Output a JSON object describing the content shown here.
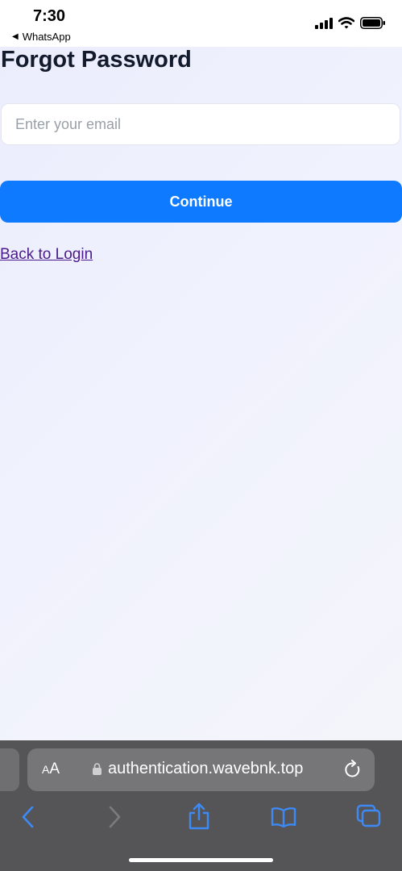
{
  "status_bar": {
    "time": "7:30",
    "back_app": "WhatsApp",
    "icons": [
      "signal-icon",
      "wifi-icon",
      "battery-icon"
    ]
  },
  "page": {
    "title": "Forgot Password",
    "email": {
      "placeholder": "Enter your email",
      "value": ""
    },
    "continue_label": "Continue",
    "back_to_login": "Back to Login"
  },
  "browser": {
    "aa_small": "A",
    "aa_big": "A",
    "url": "authentication.wavebnk.top",
    "toolbar": [
      "back-icon",
      "forward-icon",
      "share-icon",
      "bookmarks-icon",
      "tabs-icon"
    ]
  },
  "colors": {
    "accent": "#0d7aff",
    "link": "#4a1a8c",
    "toolbar_icon": "#3d8af7",
    "toolbar_disabled": "#7b7b7e"
  }
}
